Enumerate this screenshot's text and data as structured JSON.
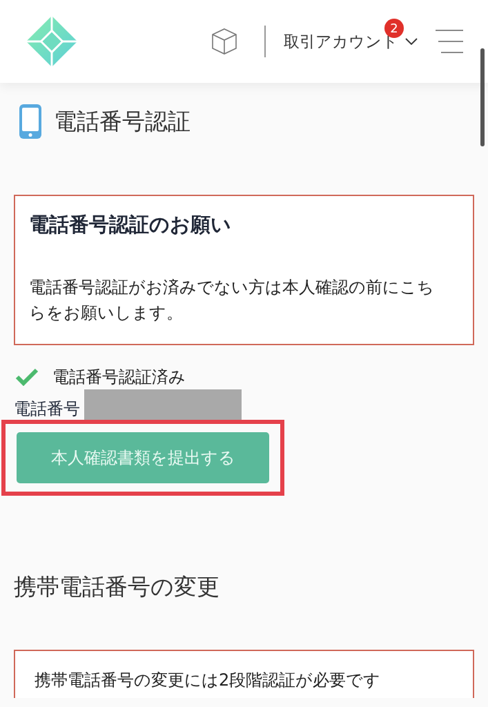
{
  "header": {
    "account_menu": "取引アカウント",
    "notification_count": "2"
  },
  "page_title": "電話番号認証",
  "request_card": {
    "title": "電話番号認証のお願い",
    "body": "電話番号認証がお済みでない方は本人確認の前にこちらをお願いします。"
  },
  "verification": {
    "verified": true,
    "status": "電話番号認証済み",
    "phone_label": "電話番号"
  },
  "submit_button": {
    "label": "本人確認書類を提出する",
    "highlighted": true
  },
  "change_section": {
    "title": "携帯電話番号の変更",
    "notice": "携帯電話番号の変更には2段階認証が必要です"
  }
}
